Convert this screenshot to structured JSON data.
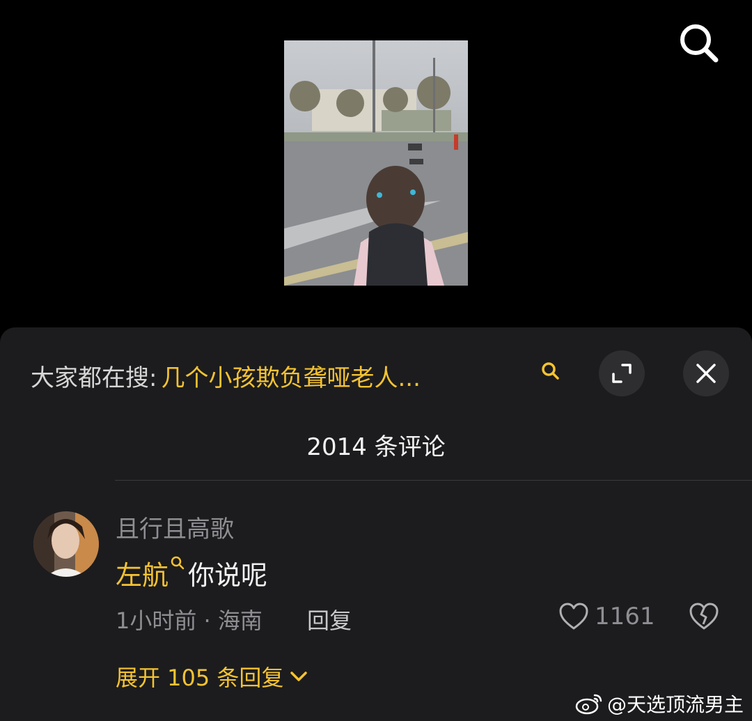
{
  "video": {
    "thumbnail_icon": "video-thumbnail-child-road",
    "search_icon": "search-icon"
  },
  "sheet": {
    "trending_prefix": "大家都在搜:",
    "trending_query": "几个小孩欺负聋哑老人...",
    "comment_count_title": "2014 条评论"
  },
  "comment": {
    "username": "且行且高歌",
    "link_text": "左航",
    "text": "你说呢",
    "meta": "1小时前 · 海南",
    "reply_label": "回复",
    "like_count": "1161",
    "expand_label": "展开 105 条回复"
  },
  "watermark": {
    "text": "@天选顶流男主"
  },
  "colors": {
    "accent": "#f5c332",
    "sheet_bg": "#1c1c1e",
    "muted": "#8e8e93"
  }
}
